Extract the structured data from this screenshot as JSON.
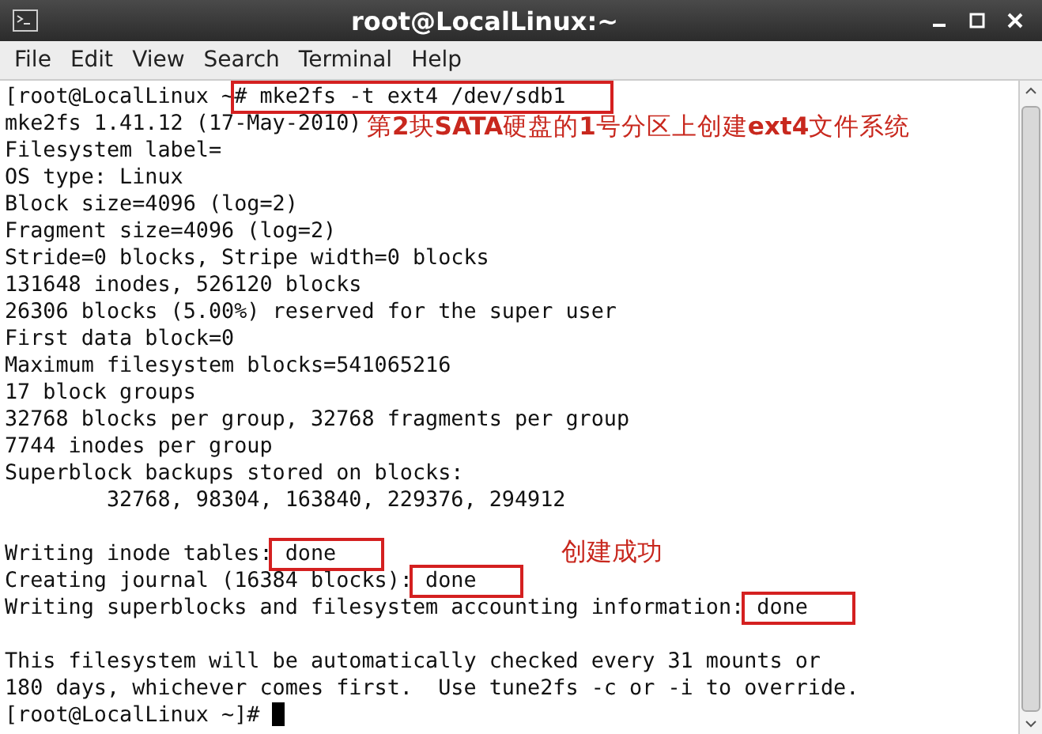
{
  "window": {
    "title": "root@LocalLinux:~"
  },
  "menu": [
    "File",
    "Edit",
    "View",
    "Search",
    "Terminal",
    "Help"
  ],
  "lines": [
    {
      "segments": [
        {
          "text": "[root@LocalLinux ~",
          "boxed": false
        },
        {
          "text": "# mke2fs -t ext4 /dev/sdb1",
          "boxed": true
        }
      ]
    },
    {
      "segments": [
        {
          "text": "mke2fs 1.41.12 (17-May-2010)",
          "boxed": false
        }
      ]
    },
    {
      "segments": [
        {
          "text": "Filesystem label=",
          "boxed": false
        }
      ]
    },
    {
      "segments": [
        {
          "text": "OS type: Linux",
          "boxed": false
        }
      ]
    },
    {
      "segments": [
        {
          "text": "Block size=4096 (log=2)",
          "boxed": false
        }
      ]
    },
    {
      "segments": [
        {
          "text": "Fragment size=4096 (log=2)",
          "boxed": false
        }
      ]
    },
    {
      "segments": [
        {
          "text": "Stride=0 blocks, Stripe width=0 blocks",
          "boxed": false
        }
      ]
    },
    {
      "segments": [
        {
          "text": "131648 inodes, 526120 blocks",
          "boxed": false
        }
      ]
    },
    {
      "segments": [
        {
          "text": "26306 blocks (5.00%) reserved for the super user",
          "boxed": false
        }
      ]
    },
    {
      "segments": [
        {
          "text": "First data block=0",
          "boxed": false
        }
      ]
    },
    {
      "segments": [
        {
          "text": "Maximum filesystem blocks=541065216",
          "boxed": false
        }
      ]
    },
    {
      "segments": [
        {
          "text": "17 block groups",
          "boxed": false
        }
      ]
    },
    {
      "segments": [
        {
          "text": "32768 blocks per group, 32768 fragments per group",
          "boxed": false
        }
      ]
    },
    {
      "segments": [
        {
          "text": "7744 inodes per group",
          "boxed": false
        }
      ]
    },
    {
      "segments": [
        {
          "text": "Superblock backups stored on blocks:",
          "boxed": false
        }
      ]
    },
    {
      "segments": [
        {
          "text": "        32768, 98304, 163840, 229376, 294912",
          "boxed": false
        }
      ]
    },
    {
      "kind": "blank"
    },
    {
      "segments": [
        {
          "text": "Writing inode tables:",
          "boxed": false
        },
        {
          "text": " done",
          "boxed": true
        }
      ]
    },
    {
      "segments": [
        {
          "text": "Creating journal (16384 blocks):",
          "boxed": false
        },
        {
          "text": " done",
          "boxed": true
        }
      ]
    },
    {
      "segments": [
        {
          "text": "Writing superblocks and filesystem accounting information:",
          "boxed": false
        },
        {
          "text": " done",
          "boxed": true
        }
      ]
    },
    {
      "kind": "blank"
    },
    {
      "segments": [
        {
          "text": "This filesystem will be automatically checked every 31 mounts or",
          "boxed": false
        }
      ]
    },
    {
      "segments": [
        {
          "text": "180 days, whichever comes first.  Use tune2fs -c or -i to override.",
          "boxed": false
        }
      ]
    },
    {
      "segments": [
        {
          "text": "[root@LocalLinux ~]# ",
          "boxed": false
        }
      ],
      "cursor": true
    }
  ],
  "annotations": [
    {
      "text": "第**2**块**SATA**硬盘的**1**号分区上创建**ext4**文件系统",
      "kind": "top"
    },
    {
      "text": "创建成功",
      "kind": "middle"
    }
  ]
}
